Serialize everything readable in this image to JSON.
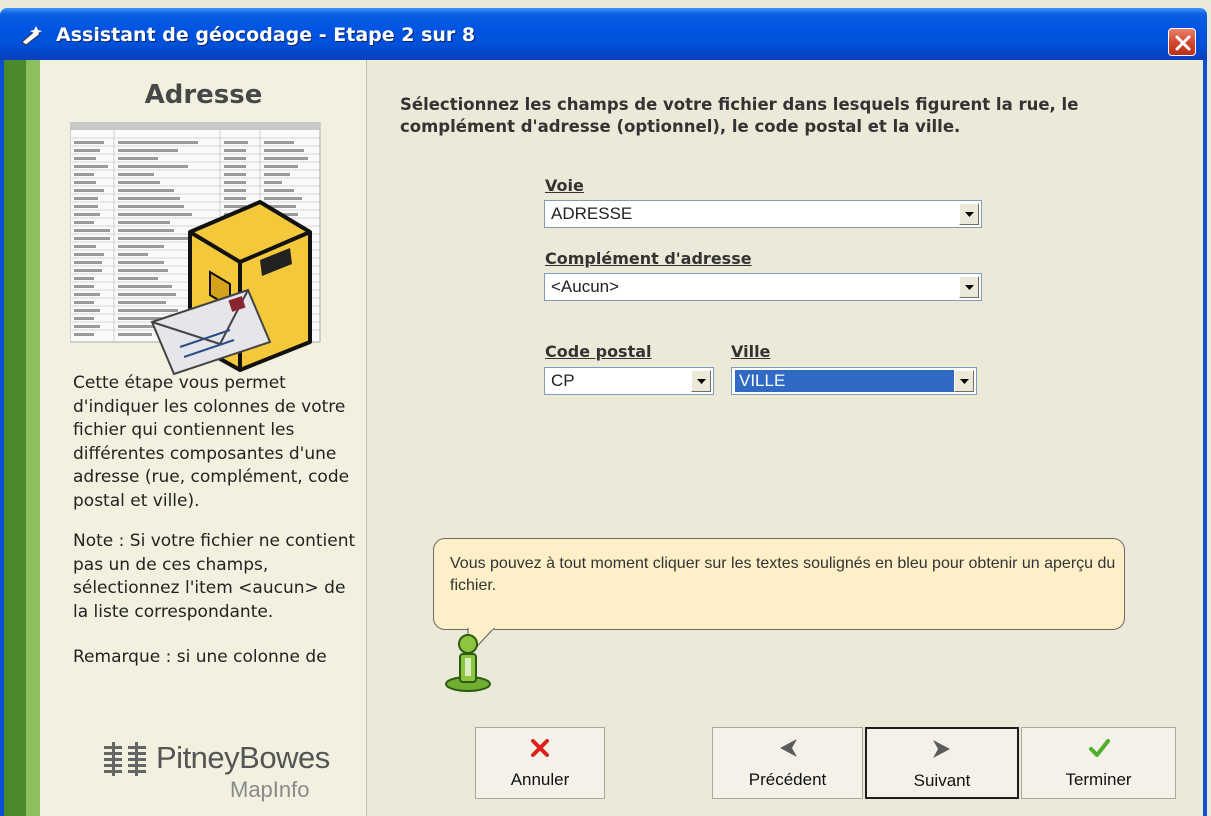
{
  "window": {
    "title": "Assistant de géocodage - Etape 2 sur 8"
  },
  "left_panel": {
    "title": "Adresse",
    "description": "Cette étape vous permet d'indiquer les colonnes de votre fichier qui contiennent les différentes composantes d'une adresse (rue, complément, code postal et ville).",
    "note": "Note : Si votre fichier ne contient pas un de ces champs, sélectionnez l'item <aucun> de la liste correspondante.",
    "remark": "Remarque : si une colonne de",
    "logo_name": "PitneyBowes",
    "logo_sub": "MapInfo"
  },
  "main": {
    "instructions": "Sélectionnez les champs de votre fichier dans lesquels figurent la rue, le complément d'adresse (optionnel), le code postal et la ville.",
    "fields": {
      "voie": {
        "label": "Voie",
        "value": "ADRESSE"
      },
      "complement": {
        "label": "Complément d'adresse",
        "value": "<Aucun>"
      },
      "code_postal": {
        "label": "Code postal",
        "value": "CP"
      },
      "ville": {
        "label": "Ville",
        "value": "VILLE"
      }
    },
    "tooltip": "Vous pouvez à tout moment cliquer sur les textes soulignés en bleu pour obtenir un aperçu du fichier."
  },
  "buttons": {
    "cancel": "Annuler",
    "previous": "Précédent",
    "next": "Suivant",
    "finish": "Terminer"
  },
  "colors": {
    "titlebar": "#0054e3",
    "panel_bg": "#ece9d8",
    "left_panel_bg": "#f2f1e0",
    "green_dark": "#4b8a2c",
    "green_light": "#8cbf5d",
    "selection": "#316ac5",
    "tooltip_bg": "#fdf0c8",
    "cancel_icon": "#e02020",
    "finish_icon": "#4fae2a"
  },
  "icons": {
    "title": "wizard-wand-icon",
    "close": "close-icon",
    "cancel": "red-x-icon",
    "previous": "arrow-left-icon",
    "next": "arrow-right-icon",
    "finish": "checkmark-icon",
    "info": "info-person-icon",
    "illustration": "mailbox-envelope-table-illustration"
  }
}
